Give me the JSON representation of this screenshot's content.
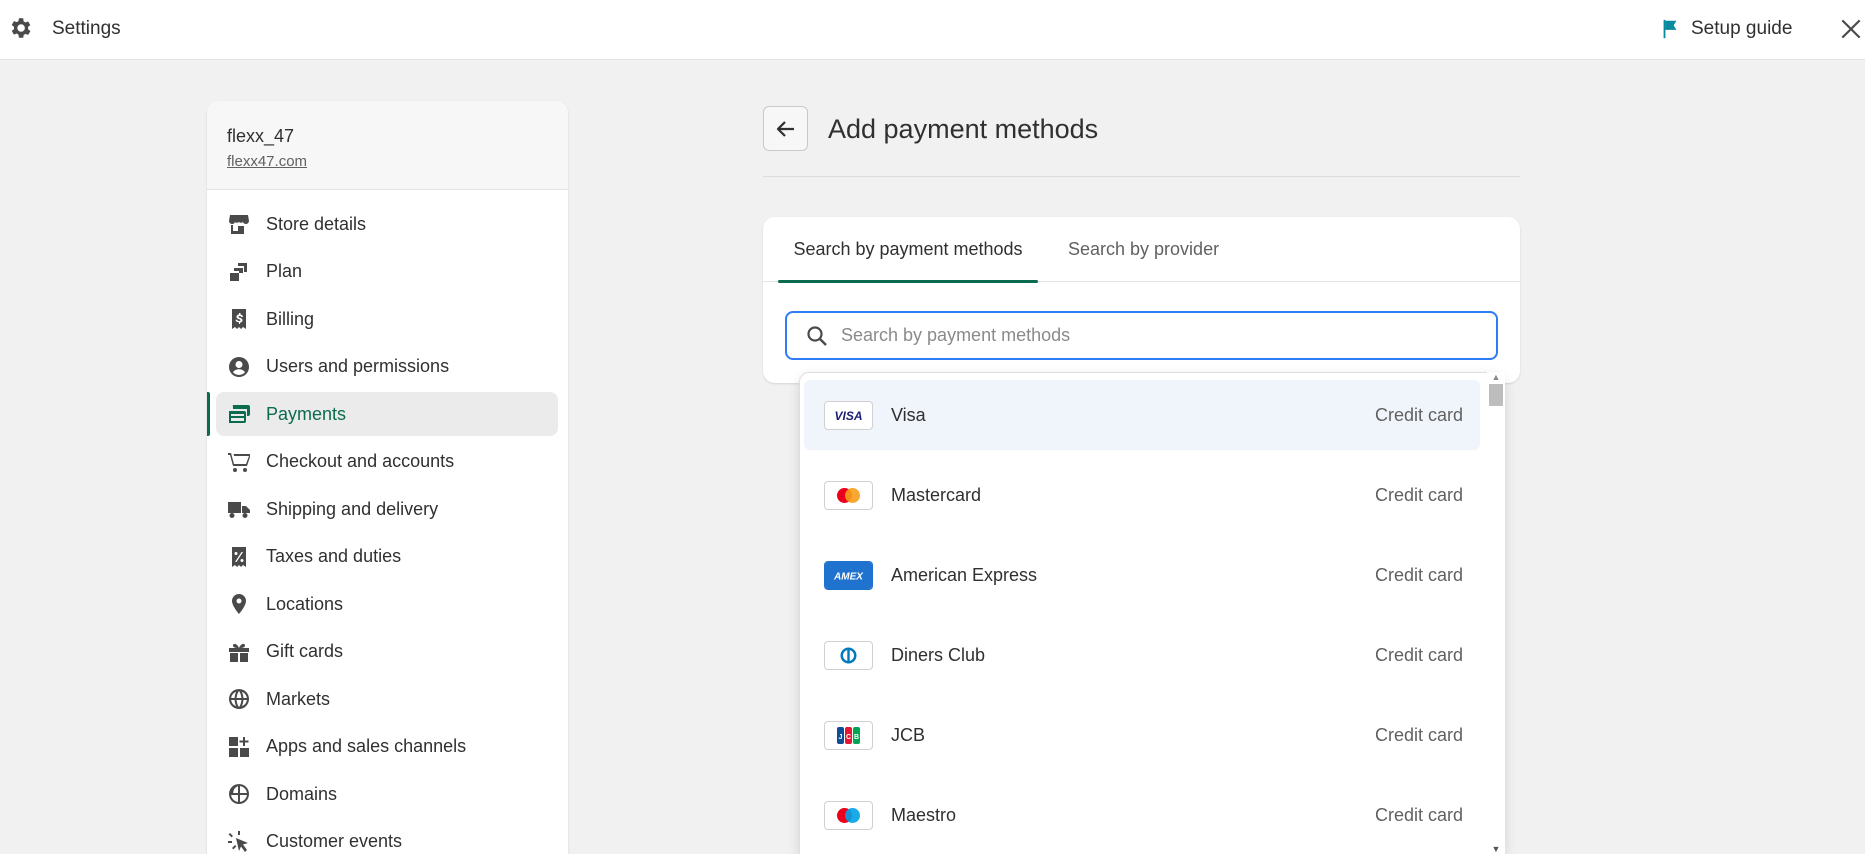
{
  "topbar": {
    "title": "Settings",
    "setup_label": "Setup guide",
    "icons": {
      "settings": "gear-icon",
      "setup": "flag-icon",
      "close": "close-icon"
    }
  },
  "sidebar": {
    "store_name": "flexx_47",
    "store_url": "flexx47.com",
    "items": [
      {
        "label": "Store details",
        "icon": "store-icon"
      },
      {
        "label": "Plan",
        "icon": "plan-icon"
      },
      {
        "label": "Billing",
        "icon": "billing-icon"
      },
      {
        "label": "Users and permissions",
        "icon": "user-icon"
      },
      {
        "label": "Payments",
        "icon": "payments-icon",
        "active": true
      },
      {
        "label": "Checkout and accounts",
        "icon": "cart-icon"
      },
      {
        "label": "Shipping and delivery",
        "icon": "truck-icon"
      },
      {
        "label": "Taxes and duties",
        "icon": "tax-icon"
      },
      {
        "label": "Locations",
        "icon": "location-icon"
      },
      {
        "label": "Gift cards",
        "icon": "gift-icon"
      },
      {
        "label": "Markets",
        "icon": "globe-icon"
      },
      {
        "label": "Apps and sales channels",
        "icon": "apps-icon"
      },
      {
        "label": "Domains",
        "icon": "domains-icon"
      },
      {
        "label": "Customer events",
        "icon": "events-icon"
      }
    ]
  },
  "main": {
    "title": "Add payment methods",
    "tabs": [
      {
        "label": "Search by payment methods",
        "active": true
      },
      {
        "label": "Search by provider",
        "active": false
      }
    ],
    "search": {
      "placeholder": "Search by payment methods",
      "value": ""
    },
    "results": [
      {
        "name": "Visa",
        "type": "Credit card",
        "logo": "visa-logo",
        "highlighted": true
      },
      {
        "name": "Mastercard",
        "type": "Credit card",
        "logo": "mastercard-logo"
      },
      {
        "name": "American Express",
        "type": "Credit card",
        "logo": "amex-logo"
      },
      {
        "name": "Diners Club",
        "type": "Credit card",
        "logo": "diners-logo"
      },
      {
        "name": "JCB",
        "type": "Credit card",
        "logo": "jcb-logo"
      },
      {
        "name": "Maestro",
        "type": "Credit card",
        "logo": "maestro-logo"
      }
    ]
  },
  "colors": {
    "accent": "#0a6b4f",
    "focus": "#2e7cf6",
    "background": "#f1f1f1"
  }
}
